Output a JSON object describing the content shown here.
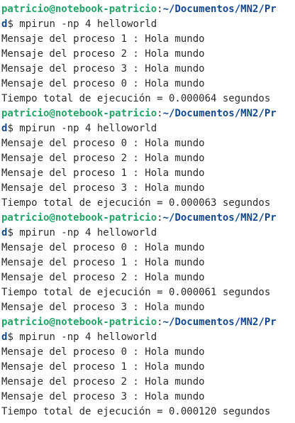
{
  "terminal": {
    "colors": {
      "user": "#26a269",
      "path": "#12488b",
      "text": "#2b2b2b",
      "background": "#ffffff"
    },
    "prompt": {
      "user_host": "patricio@notebook-patricio",
      "separator": ":",
      "path_start": "~/Documentos/MN2/Pr",
      "path_end": "d",
      "symbol": "$ "
    },
    "blocks": [
      {
        "command": "mpirun -np 4 helloworld",
        "output": [
          "Mensaje del proceso 1 : Hola mundo",
          "Mensaje del proceso 2 : Hola mundo",
          "Mensaje del proceso 3 : Hola mundo",
          "Mensaje del proceso 0 : Hola mundo",
          "Tiempo total de ejecución = 0.000064 segundos"
        ]
      },
      {
        "command": "mpirun -np 4 helloworld",
        "output": [
          "Mensaje del proceso 0 : Hola mundo",
          "Mensaje del proceso 2 : Hola mundo",
          "Mensaje del proceso 1 : Hola mundo",
          "Mensaje del proceso 3 : Hola mundo",
          "Tiempo total de ejecución = 0.000063 segundos"
        ]
      },
      {
        "command": "mpirun -np 4 helloworld",
        "output": [
          "Mensaje del proceso 0 : Hola mundo",
          "Mensaje del proceso 1 : Hola mundo",
          "Mensaje del proceso 2 : Hola mundo",
          "Tiempo total de ejecución = 0.000061 segundos",
          "Mensaje del proceso 3 : Hola mundo"
        ]
      },
      {
        "command": "mpirun -np 4 helloworld",
        "output": [
          "Mensaje del proceso 0 : Hola mundo",
          "Mensaje del proceso 1 : Hola mundo",
          "Mensaje del proceso 2 : Hola mundo",
          "Mensaje del proceso 3 : Hola mundo",
          "Tiempo total de ejecución = 0.000120 segundos"
        ]
      }
    ]
  }
}
